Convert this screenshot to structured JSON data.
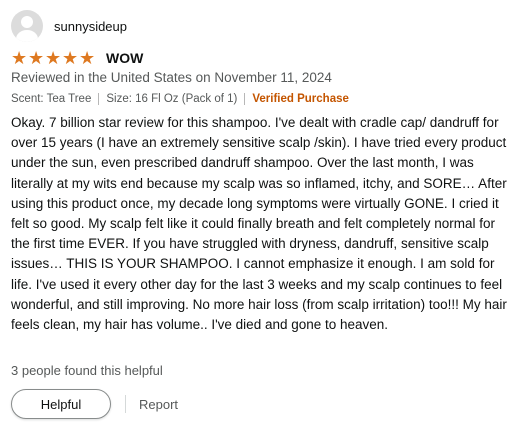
{
  "profile": {
    "name": "sunnysideup"
  },
  "rating": {
    "value": 5,
    "max": 5
  },
  "review": {
    "title": "WOW",
    "reviewed_on": "Reviewed in the United States on November 11, 2024",
    "scent": "Scent: Tea Tree",
    "size": "Size: 16 Fl Oz (Pack of 1)",
    "verified": "Verified Purchase",
    "body": "Okay. 7 billion star review for this shampoo. I've dealt with cradle cap/ dandruff for over 15 years (I have an extremely sensitive scalp /skin). I have tried every product under the sun, even prescribed dandruff shampoo. Over the last month, I was literally at my wits end because my scalp was so inflamed, itchy, and SORE… After using this product once, my decade long symptoms were virtually GONE. I cried it felt so good. My scalp felt like it could finally breath and felt completely normal for the first time EVER. If you have struggled with dryness, dandruff, sensitive scalp issues… THIS IS YOUR SHAMPOO. I cannot emphasize it enough. I am sold for life. I've used it every other day for the last 3 weeks and my scalp continues to feel wonderful, and still improving. No more hair loss (from scalp irritation) too!!! My hair feels clean, my hair has volume.. I've died and gone to heaven."
  },
  "helpful_count": "3 people found this helpful",
  "actions": {
    "helpful_label": "Helpful",
    "report_label": "Report"
  },
  "colors": {
    "star": "#de7921",
    "verified": "#c45500",
    "secondary_text": "#565959"
  }
}
